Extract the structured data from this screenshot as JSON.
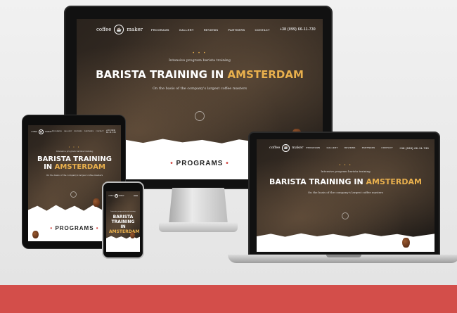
{
  "site": {
    "logo": {
      "line1": "coffee",
      "line2": "maker"
    },
    "menu": [
      "PROGRAMS",
      "GALLERY",
      "REVIEWS",
      "PARTNERS",
      "CONTACT"
    ],
    "phone": "+38 (099) 66-11-730",
    "dots": "• • •",
    "tagline": "Intensive program barista training",
    "title_pre": "BARISTA TRAINING IN ",
    "title_hl": "AMSTERDAM",
    "subtitle": "On the basis of the company's largest coffee masters",
    "programs": "PROGRAMS",
    "programs_dot": "•"
  },
  "colors": {
    "accent": "#e9b04d",
    "bar": "#d34e4a"
  }
}
